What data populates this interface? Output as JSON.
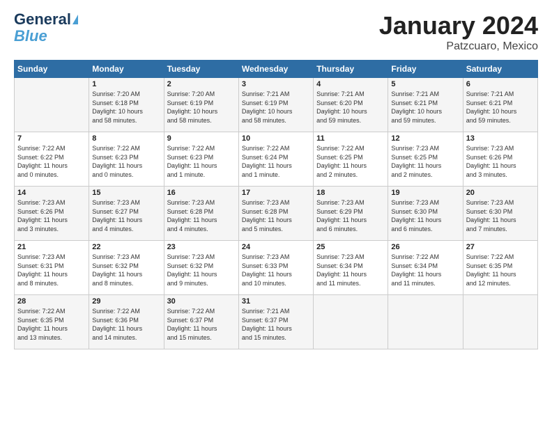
{
  "logo": {
    "line1": "General",
    "line2": "Blue"
  },
  "header": {
    "month": "January 2024",
    "location": "Patzcuaro, Mexico"
  },
  "weekdays": [
    "Sunday",
    "Monday",
    "Tuesday",
    "Wednesday",
    "Thursday",
    "Friday",
    "Saturday"
  ],
  "weeks": [
    [
      {
        "day": "",
        "info": ""
      },
      {
        "day": "1",
        "info": "Sunrise: 7:20 AM\nSunset: 6:18 PM\nDaylight: 10 hours\nand 58 minutes."
      },
      {
        "day": "2",
        "info": "Sunrise: 7:20 AM\nSunset: 6:19 PM\nDaylight: 10 hours\nand 58 minutes."
      },
      {
        "day": "3",
        "info": "Sunrise: 7:21 AM\nSunset: 6:19 PM\nDaylight: 10 hours\nand 58 minutes."
      },
      {
        "day": "4",
        "info": "Sunrise: 7:21 AM\nSunset: 6:20 PM\nDaylight: 10 hours\nand 59 minutes."
      },
      {
        "day": "5",
        "info": "Sunrise: 7:21 AM\nSunset: 6:21 PM\nDaylight: 10 hours\nand 59 minutes."
      },
      {
        "day": "6",
        "info": "Sunrise: 7:21 AM\nSunset: 6:21 PM\nDaylight: 10 hours\nand 59 minutes."
      }
    ],
    [
      {
        "day": "7",
        "info": "Sunrise: 7:22 AM\nSunset: 6:22 PM\nDaylight: 11 hours\nand 0 minutes."
      },
      {
        "day": "8",
        "info": "Sunrise: 7:22 AM\nSunset: 6:23 PM\nDaylight: 11 hours\nand 0 minutes."
      },
      {
        "day": "9",
        "info": "Sunrise: 7:22 AM\nSunset: 6:23 PM\nDaylight: 11 hours\nand 1 minute."
      },
      {
        "day": "10",
        "info": "Sunrise: 7:22 AM\nSunset: 6:24 PM\nDaylight: 11 hours\nand 1 minute."
      },
      {
        "day": "11",
        "info": "Sunrise: 7:22 AM\nSunset: 6:25 PM\nDaylight: 11 hours\nand 2 minutes."
      },
      {
        "day": "12",
        "info": "Sunrise: 7:23 AM\nSunset: 6:25 PM\nDaylight: 11 hours\nand 2 minutes."
      },
      {
        "day": "13",
        "info": "Sunrise: 7:23 AM\nSunset: 6:26 PM\nDaylight: 11 hours\nand 3 minutes."
      }
    ],
    [
      {
        "day": "14",
        "info": "Sunrise: 7:23 AM\nSunset: 6:26 PM\nDaylight: 11 hours\nand 3 minutes."
      },
      {
        "day": "15",
        "info": "Sunrise: 7:23 AM\nSunset: 6:27 PM\nDaylight: 11 hours\nand 4 minutes."
      },
      {
        "day": "16",
        "info": "Sunrise: 7:23 AM\nSunset: 6:28 PM\nDaylight: 11 hours\nand 4 minutes."
      },
      {
        "day": "17",
        "info": "Sunrise: 7:23 AM\nSunset: 6:28 PM\nDaylight: 11 hours\nand 5 minutes."
      },
      {
        "day": "18",
        "info": "Sunrise: 7:23 AM\nSunset: 6:29 PM\nDaylight: 11 hours\nand 6 minutes."
      },
      {
        "day": "19",
        "info": "Sunrise: 7:23 AM\nSunset: 6:30 PM\nDaylight: 11 hours\nand 6 minutes."
      },
      {
        "day": "20",
        "info": "Sunrise: 7:23 AM\nSunset: 6:30 PM\nDaylight: 11 hours\nand 7 minutes."
      }
    ],
    [
      {
        "day": "21",
        "info": "Sunrise: 7:23 AM\nSunset: 6:31 PM\nDaylight: 11 hours\nand 8 minutes."
      },
      {
        "day": "22",
        "info": "Sunrise: 7:23 AM\nSunset: 6:32 PM\nDaylight: 11 hours\nand 8 minutes."
      },
      {
        "day": "23",
        "info": "Sunrise: 7:23 AM\nSunset: 6:32 PM\nDaylight: 11 hours\nand 9 minutes."
      },
      {
        "day": "24",
        "info": "Sunrise: 7:23 AM\nSunset: 6:33 PM\nDaylight: 11 hours\nand 10 minutes."
      },
      {
        "day": "25",
        "info": "Sunrise: 7:23 AM\nSunset: 6:34 PM\nDaylight: 11 hours\nand 11 minutes."
      },
      {
        "day": "26",
        "info": "Sunrise: 7:22 AM\nSunset: 6:34 PM\nDaylight: 11 hours\nand 11 minutes."
      },
      {
        "day": "27",
        "info": "Sunrise: 7:22 AM\nSunset: 6:35 PM\nDaylight: 11 hours\nand 12 minutes."
      }
    ],
    [
      {
        "day": "28",
        "info": "Sunrise: 7:22 AM\nSunset: 6:35 PM\nDaylight: 11 hours\nand 13 minutes."
      },
      {
        "day": "29",
        "info": "Sunrise: 7:22 AM\nSunset: 6:36 PM\nDaylight: 11 hours\nand 14 minutes."
      },
      {
        "day": "30",
        "info": "Sunrise: 7:22 AM\nSunset: 6:37 PM\nDaylight: 11 hours\nand 15 minutes."
      },
      {
        "day": "31",
        "info": "Sunrise: 7:21 AM\nSunset: 6:37 PM\nDaylight: 11 hours\nand 15 minutes."
      },
      {
        "day": "",
        "info": ""
      },
      {
        "day": "",
        "info": ""
      },
      {
        "day": "",
        "info": ""
      }
    ]
  ]
}
